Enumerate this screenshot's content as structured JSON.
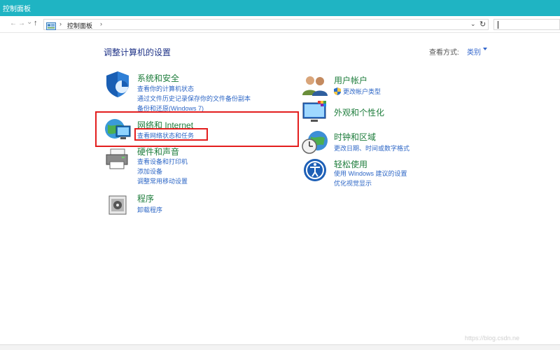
{
  "window": {
    "title": "控制面板"
  },
  "address": {
    "breadcrumb": "控制面板",
    "sep": "›"
  },
  "nav": {
    "back": "→",
    "forward": "→",
    "history": "⌄",
    "up": "↑",
    "dropdown": "⌄",
    "refresh": "↻"
  },
  "page": {
    "heading": "调整计算机的设置",
    "view_by_label": "查看方式:",
    "view_by_value": "类别"
  },
  "categories": [
    {
      "id": "system",
      "title": "系统和安全",
      "links": [
        "查看你的计算机状态",
        "通过文件历史记录保存你的文件备份副本",
        "备份和还原(Windows 7)"
      ]
    },
    {
      "id": "network",
      "title": "网络和 Internet",
      "links": [
        "查看网络状态和任务"
      ]
    },
    {
      "id": "hardware",
      "title": "硬件和声音",
      "links": [
        "查看设备和打印机",
        "添加设备",
        "调整常用移动设置"
      ]
    },
    {
      "id": "programs",
      "title": "程序",
      "links": [
        "卸载程序"
      ]
    },
    {
      "id": "user",
      "title": "用户帐户",
      "links": [
        "更改帐户类型"
      ]
    },
    {
      "id": "appearance",
      "title": "外观和个性化",
      "links": []
    },
    {
      "id": "clock",
      "title": "时钟和区域",
      "links": [
        "更改日期、时间或数字格式"
      ]
    },
    {
      "id": "ease",
      "title": "轻松使用",
      "links": [
        "使用 Windows 建议的设置",
        "优化视觉显示"
      ]
    }
  ],
  "watermark": "https://blog.csdn.ne",
  "colors": {
    "titlebar": "#1fb4c3",
    "category_title": "#1e7d3c",
    "link": "#2e67c6",
    "highlight": "#e31e1e"
  }
}
